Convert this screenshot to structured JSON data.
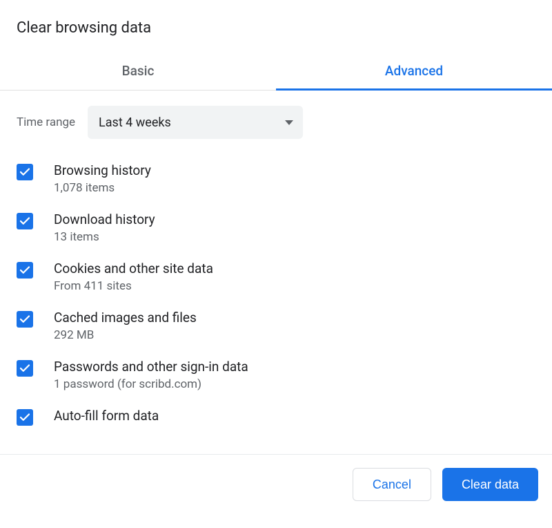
{
  "title": "Clear browsing data",
  "tabs": {
    "basic": "Basic",
    "advanced": "Advanced",
    "active": "advanced"
  },
  "time_range": {
    "label": "Time range",
    "selected": "Last 4 weeks"
  },
  "items": [
    {
      "title": "Browsing history",
      "sub": "1,078 items",
      "checked": true
    },
    {
      "title": "Download history",
      "sub": "13 items",
      "checked": true
    },
    {
      "title": "Cookies and other site data",
      "sub": "From 411 sites",
      "checked": true
    },
    {
      "title": "Cached images and files",
      "sub": "292 MB",
      "checked": true
    },
    {
      "title": "Passwords and other sign-in data",
      "sub": "1 password (for scribd.com)",
      "checked": true
    },
    {
      "title": "Auto-fill form data",
      "sub": "",
      "checked": true
    }
  ],
  "buttons": {
    "cancel": "Cancel",
    "clear": "Clear data"
  }
}
